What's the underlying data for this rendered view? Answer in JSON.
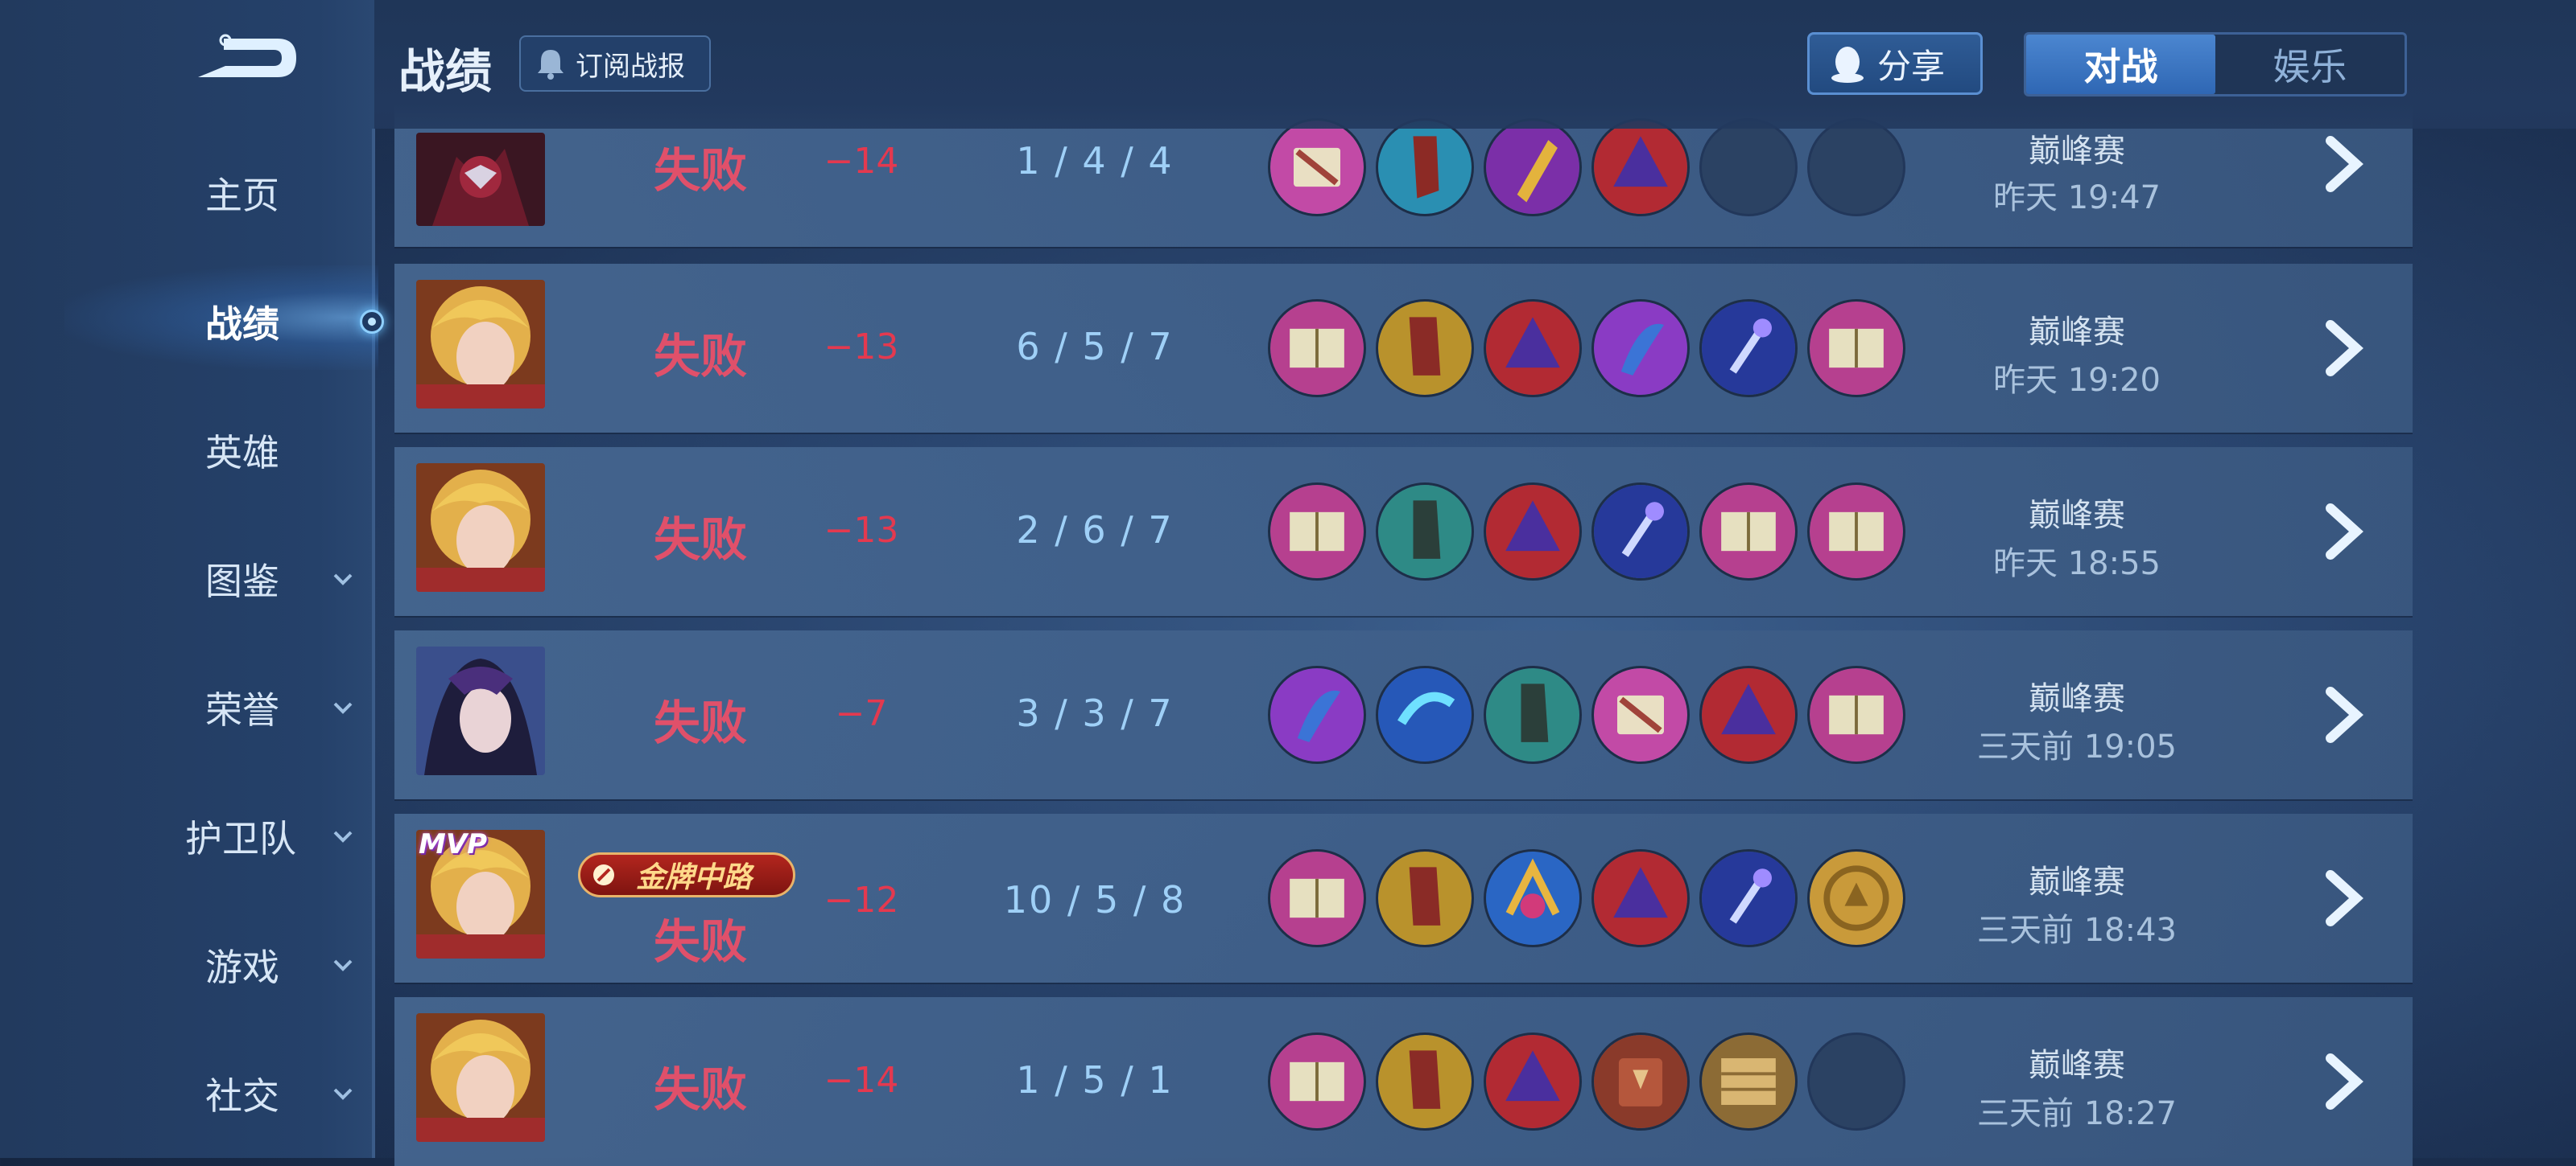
{
  "header": {
    "title": "战绩",
    "subscribe_label": "订阅战报",
    "share_label": "分享",
    "tabs": [
      {
        "label": "对战",
        "active": true
      },
      {
        "label": "娱乐",
        "active": false
      }
    ]
  },
  "sidebar": {
    "items": [
      {
        "label": "主页",
        "has_submenu": false
      },
      {
        "label": "战绩",
        "has_submenu": false,
        "active": true
      },
      {
        "label": "英雄",
        "has_submenu": false
      },
      {
        "label": "图鉴",
        "has_submenu": true
      },
      {
        "label": "荣誉",
        "has_submenu": true
      },
      {
        "label": "护卫队",
        "has_submenu": true
      },
      {
        "label": "游戏",
        "has_submenu": true
      },
      {
        "label": "社交",
        "has_submenu": true
      }
    ]
  },
  "matches": [
    {
      "result": "失败",
      "score": "−14",
      "kda": "1 / 4 / 4",
      "mode": "巅峰赛",
      "time": "昨天 19:47"
    },
    {
      "result": "失败",
      "score": "−13",
      "kda": "6 / 5 / 7",
      "mode": "巅峰赛",
      "time": "昨天 19:20"
    },
    {
      "result": "失败",
      "score": "−13",
      "kda": "2 / 6 / 7",
      "mode": "巅峰赛",
      "time": "昨天 18:55"
    },
    {
      "result": "失败",
      "score": "−7",
      "kda": "3 / 3 / 7",
      "mode": "巅峰赛",
      "time": "三天前 19:05"
    },
    {
      "result": "失败",
      "score": "−12",
      "kda": "10 / 5 / 8",
      "mode": "巅峰赛",
      "time": "三天前 18:43",
      "mvp": "MVP",
      "badge": "金牌中路"
    },
    {
      "result": "失败",
      "score": "−14",
      "kda": "1 / 5 / 1",
      "mode": "巅峰赛",
      "time": "三天前 18:27"
    }
  ]
}
